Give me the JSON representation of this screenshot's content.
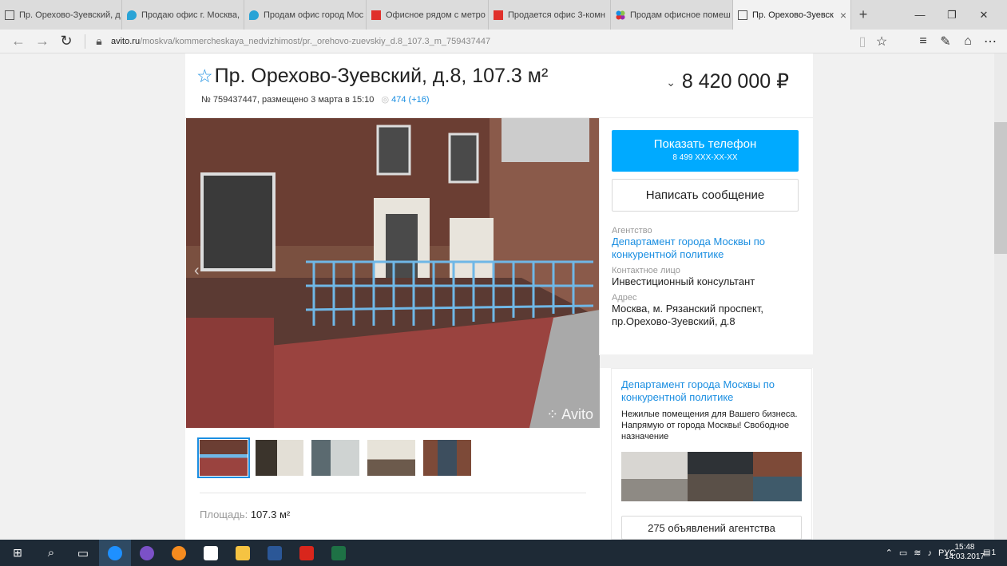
{
  "browser": {
    "tabs": [
      {
        "label": "Пр. Орехово-Зуевский, д",
        "icon": "page-icon"
      },
      {
        "label": "Продаю офис г. Москва,",
        "icon": "map-pin-icon"
      },
      {
        "label": "Продам офис город Мос",
        "icon": "map-pin-icon"
      },
      {
        "label": "Офисное рядом с метро",
        "icon": "red-logo-icon"
      },
      {
        "label": "Продается офис 3-комн",
        "icon": "red-logo-icon"
      },
      {
        "label": "Продам офисное помеш",
        "icon": "avito-dots-icon"
      },
      {
        "label": "Пр. Орехово-Зуевск",
        "icon": "page-icon",
        "active": true
      }
    ],
    "url_host": "avito.ru",
    "url_path": "/moskva/kommercheskaya_nedvizhimost/pr._orehovo-zuevskiy_d.8_107.3_m_759437447"
  },
  "listing": {
    "title": "Пр. Орехово-Зуевский, д.8, 107.3 м²",
    "meta": "№ 759437447, размещено 3 марта в 15:10",
    "views": "474 (+16)",
    "price": "8 420 000 ₽",
    "watermark": "Avito",
    "area_label": "Площадь:",
    "area_value": "107.3 м²"
  },
  "sidebar": {
    "phone_button": "Показать телефон",
    "phone_number": "8 499 XXX-XX-XX",
    "message_button": "Написать сообщение",
    "agency_label": "Агентство",
    "agency_name": "Департамент города Москвы по конкурентной политике",
    "contact_label": "Контактное лицо",
    "contact_name": "Инвестиционный консультант",
    "address_label": "Адрес",
    "address": "Москва, м. Рязанский проспект, пр.Орехово-Зуевский, д.8"
  },
  "promo": {
    "title": "Департамент города Москвы по конкурентной политике",
    "description": "Нежилые помещения для Вашего бизнеса. Напрямую от города Москвы! Свободное назначение",
    "more_button": "275 объявлений агентства"
  },
  "taskbar": {
    "lang": "РУС",
    "time": "15:48",
    "date": "14.03.2017",
    "notifications": "1"
  }
}
